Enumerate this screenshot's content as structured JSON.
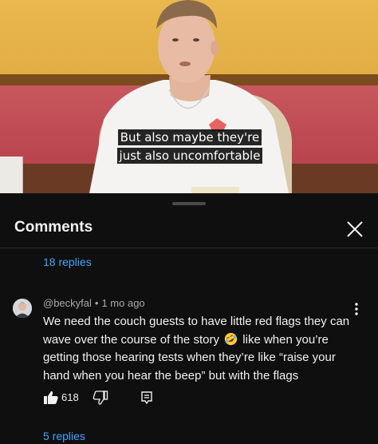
{
  "video": {
    "caption_lines": [
      "But also maybe they're",
      "just also uncomfortable"
    ]
  },
  "comments_panel": {
    "title": "Comments",
    "previous_thread_replies": "18 replies",
    "comment": {
      "author": "@beckyfal",
      "separator": "•",
      "time": "1 mo ago",
      "text_part1": "We need the couch guests to have little red flags they can wave over the course of the story",
      "emoji": "rolling-on-floor-laughing-emoji",
      "text_part2": "like when you’re getting those hearing tests when they’re like “raise your hand when you hear the beep” but with the flags",
      "likes": "618"
    },
    "comment_replies": "5 replies"
  },
  "colors": {
    "background": "#0f0f0f",
    "text_primary": "#f1f1f1",
    "text_secondary": "#aaaaaa",
    "link": "#3ea6ff"
  },
  "icons": {
    "close": "close-icon",
    "more": "more-vertical-icon",
    "like": "thumbs-up-icon",
    "dislike": "thumbs-down-icon",
    "reply": "reply-icon"
  }
}
